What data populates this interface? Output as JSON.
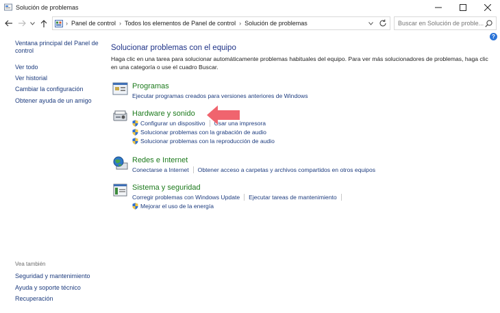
{
  "window": {
    "title": "Solución de problemas",
    "buttons": {
      "minimize": "minimize-icon",
      "maximize": "maximize-icon",
      "close": "close-icon"
    }
  },
  "address": {
    "crumbs": [
      "Panel de control",
      "Todos los elementos de Panel de control",
      "Solución de problemas"
    ],
    "search_placeholder": "Buscar en Solución de proble..."
  },
  "left_pane": {
    "links": [
      "Ventana principal del Panel de control",
      "Ver todo",
      "Ver historial",
      "Cambiar la configuración",
      "Obtener ayuda de un amigo"
    ],
    "see_also_label": "Vea también",
    "see_also": [
      "Seguridad y mantenimiento",
      "Ayuda y soporte técnico",
      "Recuperación"
    ]
  },
  "main": {
    "heading": "Solucionar problemas con el equipo",
    "description": "Haga clic en una tarea para solucionar automáticamente problemas habituales del equipo. Para ver más solucionadores de problemas, haga clic en una categoría o use el cuadro Buscar.",
    "categories": [
      {
        "title": "Programas",
        "links": [
          "Ejecutar programas creados para versiones anteriores de Windows"
        ]
      },
      {
        "title": "Hardware y sonido",
        "links": [
          "Configurar un dispositivo",
          "Usar una impresora",
          "Solucionar problemas con la grabación de audio",
          "Solucionar problemas con la reproducción de audio"
        ]
      },
      {
        "title": "Redes e Internet",
        "links": [
          "Conectarse a Internet",
          "Obtener acceso a carpetas y archivos compartidos en otros equipos"
        ]
      },
      {
        "title": "Sistema y seguridad",
        "links": [
          "Corregir problemas con Windows Update",
          "Ejecutar tareas de mantenimiento",
          "Mejorar el uso de la energía"
        ]
      }
    ]
  },
  "colors": {
    "link": "#1c3b7e",
    "category_title": "#1c7a1c",
    "heading": "#1e3287",
    "annotation_arrow": "#f0646e"
  }
}
